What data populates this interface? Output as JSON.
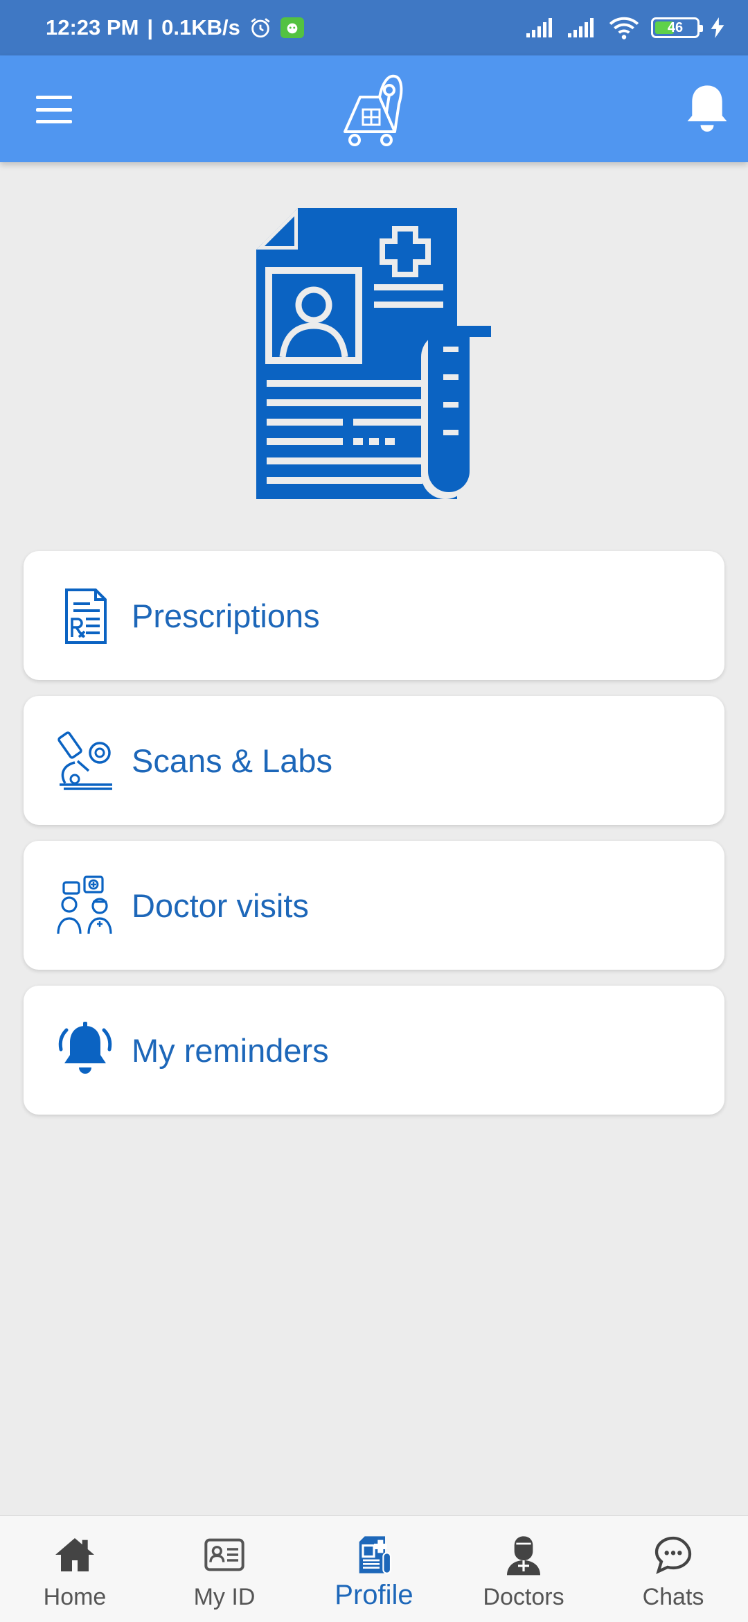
{
  "status_bar": {
    "time": "12:23 PM",
    "speed": "0.1KB/s",
    "battery": "46",
    "battery_level": 0.46,
    "icons": [
      "alarm-icon",
      "app-notification-icon",
      "signal-icon",
      "signal-icon",
      "wifi-icon",
      "battery-icon",
      "charging-icon"
    ]
  },
  "app_bar": {
    "menu_icon": "hamburger-menu-icon",
    "logo_icon": "ambulance-logo-icon",
    "notification_icon": "bell-icon"
  },
  "hero": {
    "icon": "medical-record-icon"
  },
  "menu": [
    {
      "label": "Prescriptions",
      "icon": "prescription-icon"
    },
    {
      "label": "Scans & Labs",
      "icon": "microscope-icon"
    },
    {
      "label": "Doctor visits",
      "icon": "doctors-consult-icon"
    },
    {
      "label": "My reminders",
      "icon": "ringing-bell-icon"
    }
  ],
  "bottom_nav": [
    {
      "label": "Home",
      "icon": "home-icon",
      "active": false
    },
    {
      "label": "My ID",
      "icon": "id-card-icon",
      "active": false
    },
    {
      "label": "Profile",
      "icon": "medical-profile-icon",
      "active": true
    },
    {
      "label": "Doctors",
      "icon": "doctor-icon",
      "active": false
    },
    {
      "label": "Chats",
      "icon": "chat-bubbles-icon",
      "active": false
    }
  ],
  "colors": {
    "status_bar": "#3f78c4",
    "app_bar": "#5096f0",
    "accent": "#1d67b9",
    "icon_blue": "#0b63c2",
    "background": "#ececec",
    "card": "#ffffff"
  }
}
